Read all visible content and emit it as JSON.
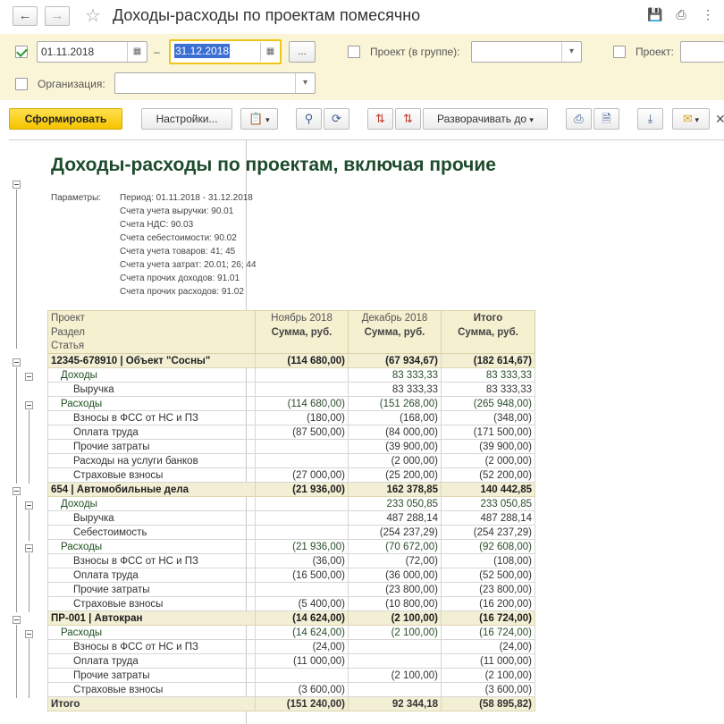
{
  "window": {
    "title": "Доходы-расходы по проектам помесячно"
  },
  "filters": {
    "date_from": "01.11.2018",
    "date_to": "31.12.2018",
    "dash": "–",
    "dots_label": "...",
    "project_group_label": "Проект (в группе):",
    "project_label": "Проект:",
    "org_label": "Организация:",
    "period_checked": true
  },
  "toolbar": {
    "generate_label": "Сформировать",
    "settings_label": "Настройки...",
    "expand_label": "Разворачивать до"
  },
  "report": {
    "title": "Доходы-расходы по проектам, включая прочие",
    "params_label": "Параметры:",
    "params": [
      "Период: 01.11.2018 - 31.12.2018",
      "Счета учета выручки: 90.01",
      "Счета НДС: 90.03",
      "Счета себестоимости: 90.02",
      "Счета учета товаров: 41; 45",
      "Счета учета затрат: 20.01; 26; 44",
      "Счета прочих доходов: 91.01",
      "Счета прочих расходов: 91.02"
    ],
    "headers": {
      "project": "Проект",
      "section": "Раздел",
      "article": "Статья",
      "col1": "Ноябрь 2018",
      "col2": "Декабрь 2018",
      "col3": "Итого",
      "sum": "Сумма, руб."
    },
    "rows": [
      {
        "level": "proj",
        "name": "12345-678910 | Объект \"Сосны\"",
        "v1": "(114 680,00)",
        "v2": "(67 934,67)",
        "v3": "(182 614,67)"
      },
      {
        "level": "sec",
        "name": "Доходы",
        "v1": "",
        "v2": "83 333,33",
        "v3": "83 333,33"
      },
      {
        "level": "art",
        "name": "Выручка",
        "v1": "",
        "v2": "83 333,33",
        "v3": "83 333,33"
      },
      {
        "level": "sec",
        "name": "Расходы",
        "v1": "(114 680,00)",
        "v2": "(151 268,00)",
        "v3": "(265 948,00)"
      },
      {
        "level": "art",
        "name": "Взносы в ФСС от НС и ПЗ",
        "v1": "(180,00)",
        "v2": "(168,00)",
        "v3": "(348,00)"
      },
      {
        "level": "art",
        "name": "Оплата труда",
        "v1": "(87 500,00)",
        "v2": "(84 000,00)",
        "v3": "(171 500,00)"
      },
      {
        "level": "art",
        "name": "Прочие затраты",
        "v1": "",
        "v2": "(39 900,00)",
        "v3": "(39 900,00)"
      },
      {
        "level": "art",
        "name": "Расходы на услуги банков",
        "v1": "",
        "v2": "(2 000,00)",
        "v3": "(2 000,00)"
      },
      {
        "level": "art",
        "name": "Страховые взносы",
        "v1": "(27 000,00)",
        "v2": "(25 200,00)",
        "v3": "(52 200,00)"
      },
      {
        "level": "proj",
        "name": "654 | Автомобильные дела",
        "v1": "(21 936,00)",
        "v2": "162 378,85",
        "v3": "140 442,85"
      },
      {
        "level": "sec",
        "name": "Доходы",
        "v1": "",
        "v2": "233 050,85",
        "v3": "233 050,85"
      },
      {
        "level": "art",
        "name": "Выручка",
        "v1": "",
        "v2": "487 288,14",
        "v3": "487 288,14"
      },
      {
        "level": "art",
        "name": "Себестоимость",
        "v1": "",
        "v2": "(254 237,29)",
        "v3": "(254 237,29)"
      },
      {
        "level": "sec",
        "name": "Расходы",
        "v1": "(21 936,00)",
        "v2": "(70 672,00)",
        "v3": "(92 608,00)"
      },
      {
        "level": "art",
        "name": "Взносы в ФСС от НС и ПЗ",
        "v1": "(36,00)",
        "v2": "(72,00)",
        "v3": "(108,00)"
      },
      {
        "level": "art",
        "name": "Оплата труда",
        "v1": "(16 500,00)",
        "v2": "(36 000,00)",
        "v3": "(52 500,00)"
      },
      {
        "level": "art",
        "name": "Прочие затраты",
        "v1": "",
        "v2": "(23 800,00)",
        "v3": "(23 800,00)"
      },
      {
        "level": "art",
        "name": "Страховые взносы",
        "v1": "(5 400,00)",
        "v2": "(10 800,00)",
        "v3": "(16 200,00)"
      },
      {
        "level": "proj",
        "name": "ПР-001 | Автокран",
        "v1": "(14 624,00)",
        "v2": "(2 100,00)",
        "v3": "(16 724,00)"
      },
      {
        "level": "sec",
        "name": "Расходы",
        "v1": "(14 624,00)",
        "v2": "(2 100,00)",
        "v3": "(16 724,00)"
      },
      {
        "level": "art",
        "name": "Взносы в ФСС от НС и ПЗ",
        "v1": "(24,00)",
        "v2": "",
        "v3": "(24,00)"
      },
      {
        "level": "art",
        "name": "Оплата труда",
        "v1": "(11 000,00)",
        "v2": "",
        "v3": "(11 000,00)"
      },
      {
        "level": "art",
        "name": "Прочие затраты",
        "v1": "",
        "v2": "(2 100,00)",
        "v3": "(2 100,00)"
      },
      {
        "level": "art",
        "name": "Страховые взносы",
        "v1": "(3 600,00)",
        "v2": "",
        "v3": "(3 600,00)"
      }
    ],
    "total": {
      "name": "Итого",
      "v1": "(151 240,00)",
      "v2": "92 344,18",
      "v3": "(58 895,82)"
    }
  }
}
